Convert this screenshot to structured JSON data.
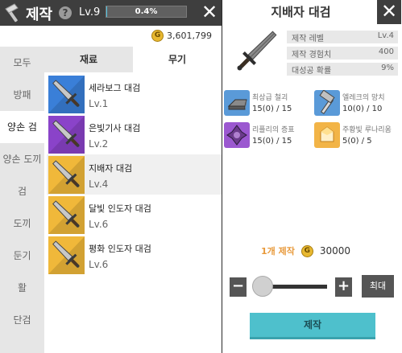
{
  "header": {
    "title": "제작",
    "help_symbol": "?",
    "level": "Lv.9",
    "xp_percent_text": "0.4%",
    "xp_fraction": 0.004,
    "close_symbol": "✕"
  },
  "gold": {
    "coin_letter": "G",
    "amount": "3,601,799"
  },
  "tabs": [
    {
      "label": "재료",
      "active": false
    },
    {
      "label": "무기",
      "active": true
    }
  ],
  "categories": [
    {
      "label": "모두",
      "active": false
    },
    {
      "label": "방패",
      "active": false
    },
    {
      "label": "양손 검",
      "active": true
    },
    {
      "label": "양손 도끼",
      "active": false
    },
    {
      "label": "검",
      "active": false
    },
    {
      "label": "도끼",
      "active": false
    },
    {
      "label": "둔기",
      "active": false
    },
    {
      "label": "활",
      "active": false
    },
    {
      "label": "단검",
      "active": false
    }
  ],
  "items": [
    {
      "name": "세라보그 대검",
      "level": "Lv.1",
      "bg": "#3a7fd8",
      "icon": "greatsword-icon"
    },
    {
      "name": "은빛기사 대검",
      "level": "Lv.2",
      "bg": "#8a43c9",
      "icon": "greatsword-icon"
    },
    {
      "name": "지배자 대검",
      "level": "Lv.4",
      "bg": "#f0b83a",
      "icon": "greatsword-icon"
    },
    {
      "name": "달빛 인도자 대검",
      "level": "Lv.6",
      "bg": "#f0b83a",
      "icon": "greatsword-icon"
    },
    {
      "name": "평화 인도자 대검",
      "level": "Lv.6",
      "bg": "#f0b83a",
      "icon": "greatsword-icon"
    }
  ],
  "detail": {
    "title": "지배자 대검",
    "stats": [
      {
        "label": "제작 레벨",
        "value": "Lv.4"
      },
      {
        "label": "제작 경험치",
        "value": "400"
      },
      {
        "label": "대성공 확률",
        "value": "9%"
      }
    ],
    "materials": [
      {
        "name": "최상급 철괴",
        "count": "15(0) / 15",
        "bg": "#5a9ad8",
        "icon": "iron-ingot-icon"
      },
      {
        "name": "엘레크의 망치",
        "count": "10(0) / 10",
        "bg": "#5a9ad8",
        "icon": "hammer-icon"
      },
      {
        "name": "리플리의 증표",
        "count": "15(0) / 15",
        "bg": "#9b58d0",
        "icon": "emblem-icon"
      },
      {
        "name": "주황빛 루나리움",
        "count": "5(0) / 5",
        "bg": "#f2b447",
        "icon": "crystal-icon"
      }
    ],
    "craft_qty_label": "1개 제작",
    "cost_coin": "G",
    "cost": "30000",
    "minus": "−",
    "plus": "+",
    "max_label": "최대",
    "craft_label": "제작",
    "slider_fraction": 0
  },
  "colors": {
    "topbar": "#3e3e3e",
    "craft_button": "#4ec0cc",
    "rare_bg": "#3a7fd8",
    "epic_bg": "#8a43c9",
    "legendary_bg": "#f0b83a"
  }
}
